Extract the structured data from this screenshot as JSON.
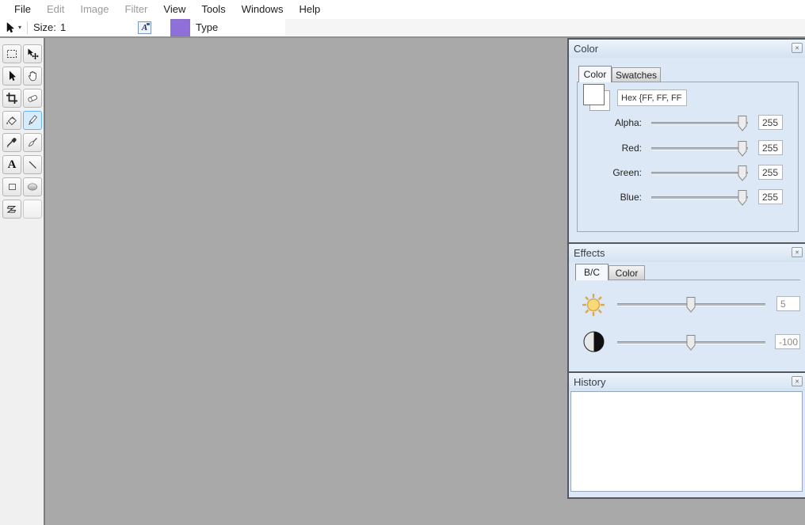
{
  "menu": {
    "items": [
      {
        "label": "File",
        "enabled": true
      },
      {
        "label": "Edit",
        "enabled": false
      },
      {
        "label": "Image",
        "enabled": false
      },
      {
        "label": "Filter",
        "enabled": false
      },
      {
        "label": "View",
        "enabled": true
      },
      {
        "label": "Tools",
        "enabled": true
      },
      {
        "label": "Windows",
        "enabled": true
      },
      {
        "label": "Help",
        "enabled": true
      }
    ]
  },
  "toolbar": {
    "size_label": "Size:",
    "size_value": "1",
    "type_label": "Type",
    "swatch_color": "#8f70d8",
    "swatch_style": "background:#8f70d8"
  },
  "icons": {
    "caret": "▾",
    "close": "✕",
    "text_tool_glyph": "A",
    "font_button_glyph": "A"
  },
  "tools": {
    "items": [
      "rectangle-select",
      "move",
      "pointer",
      "hand",
      "crop",
      "eraser",
      "paint-bucket",
      "pencil",
      "eyedropper",
      "brush",
      "text",
      "line",
      "rectangle",
      "ellipse",
      "polygon"
    ],
    "selected": "pencil"
  },
  "color_panel": {
    "title": "Color",
    "tabs": [
      "Color",
      "Swatches"
    ],
    "active_tab": "Color",
    "hex_value": "Hex {FF, FF, FF",
    "sliders": [
      {
        "label": "Alpha:",
        "value": "255"
      },
      {
        "label": "Red:",
        "value": "255"
      },
      {
        "label": "Green:",
        "value": "255"
      },
      {
        "label": "Blue:",
        "value": "255"
      }
    ]
  },
  "effects_panel": {
    "title": "Effects",
    "tabs": [
      "B/C",
      "Color"
    ],
    "active_tab": "B/C",
    "brightness_value": "5",
    "contrast_value": "-100"
  },
  "history_panel": {
    "title": "History",
    "items": []
  },
  "colors": {
    "canvas": "#a9a9a9",
    "panel_bg": "#dce8f5",
    "selected_tool_bg": "#d4ecfb",
    "accent_purple": "#8f70d8",
    "sun_yellow": "#f7d678"
  }
}
